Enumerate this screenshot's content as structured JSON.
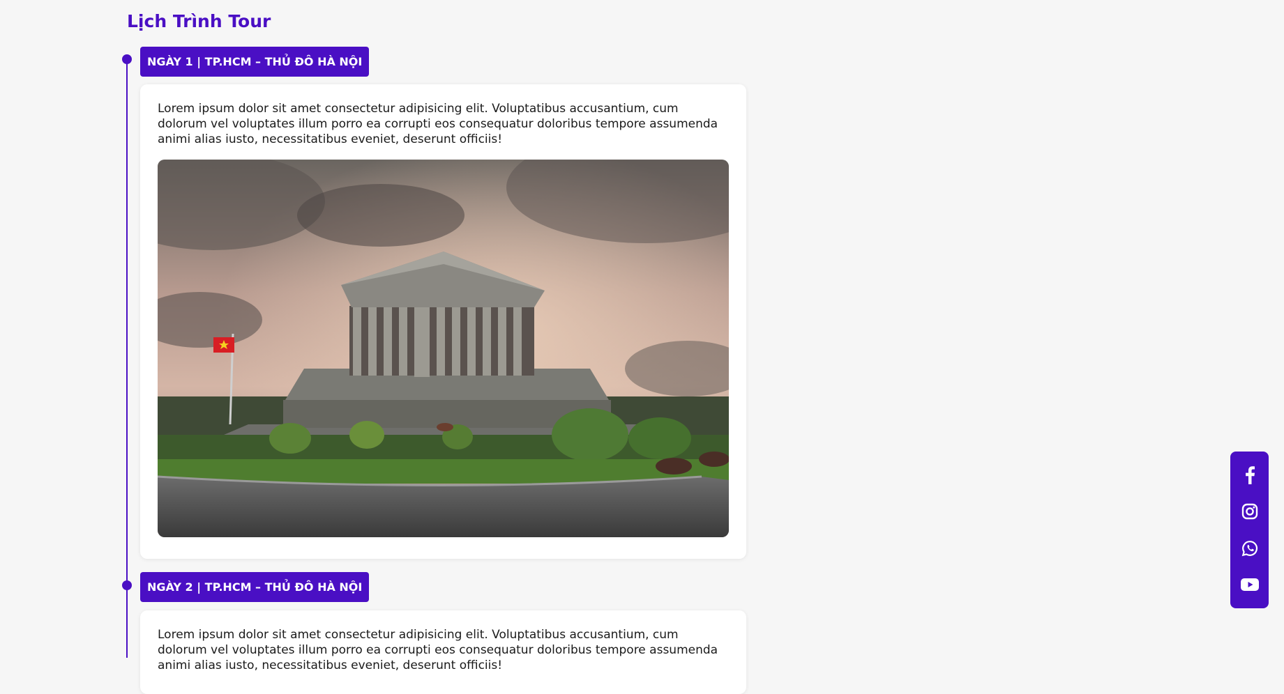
{
  "page": {
    "title": "Lịch Trình Tour"
  },
  "days": [
    {
      "label": "NGÀY 1 | TP.HCM – THỦ ĐÔ HÀ NỘI",
      "description": "Lorem ipsum dolor sit amet consectetur adipisicing elit. Voluptatibus accusantium, cum dolorum vel voluptates illum porro ea corrupti eos consequatur doloribus tempore assumenda animi alias iusto, necessitatibus eveniet, deserunt officiis!"
    },
    {
      "label": "NGÀY 2 | TP.HCM – THỦ ĐÔ HÀ NỘI",
      "description": "Lorem ipsum dolor sit amet consectetur adipisicing elit. Voluptatibus accusantium, cum dolorum vel voluptates illum porro ea corrupti eos consequatur doloribus tempore assumenda animi alias iusto, necessitatibus eveniet, deserunt officiis!"
    }
  ],
  "social": {
    "icons": [
      "facebook-icon",
      "instagram-icon",
      "whatsapp-icon",
      "youtube-icon"
    ]
  },
  "colors": {
    "accent": "#4a0fc4",
    "background": "#f6f6f6"
  }
}
